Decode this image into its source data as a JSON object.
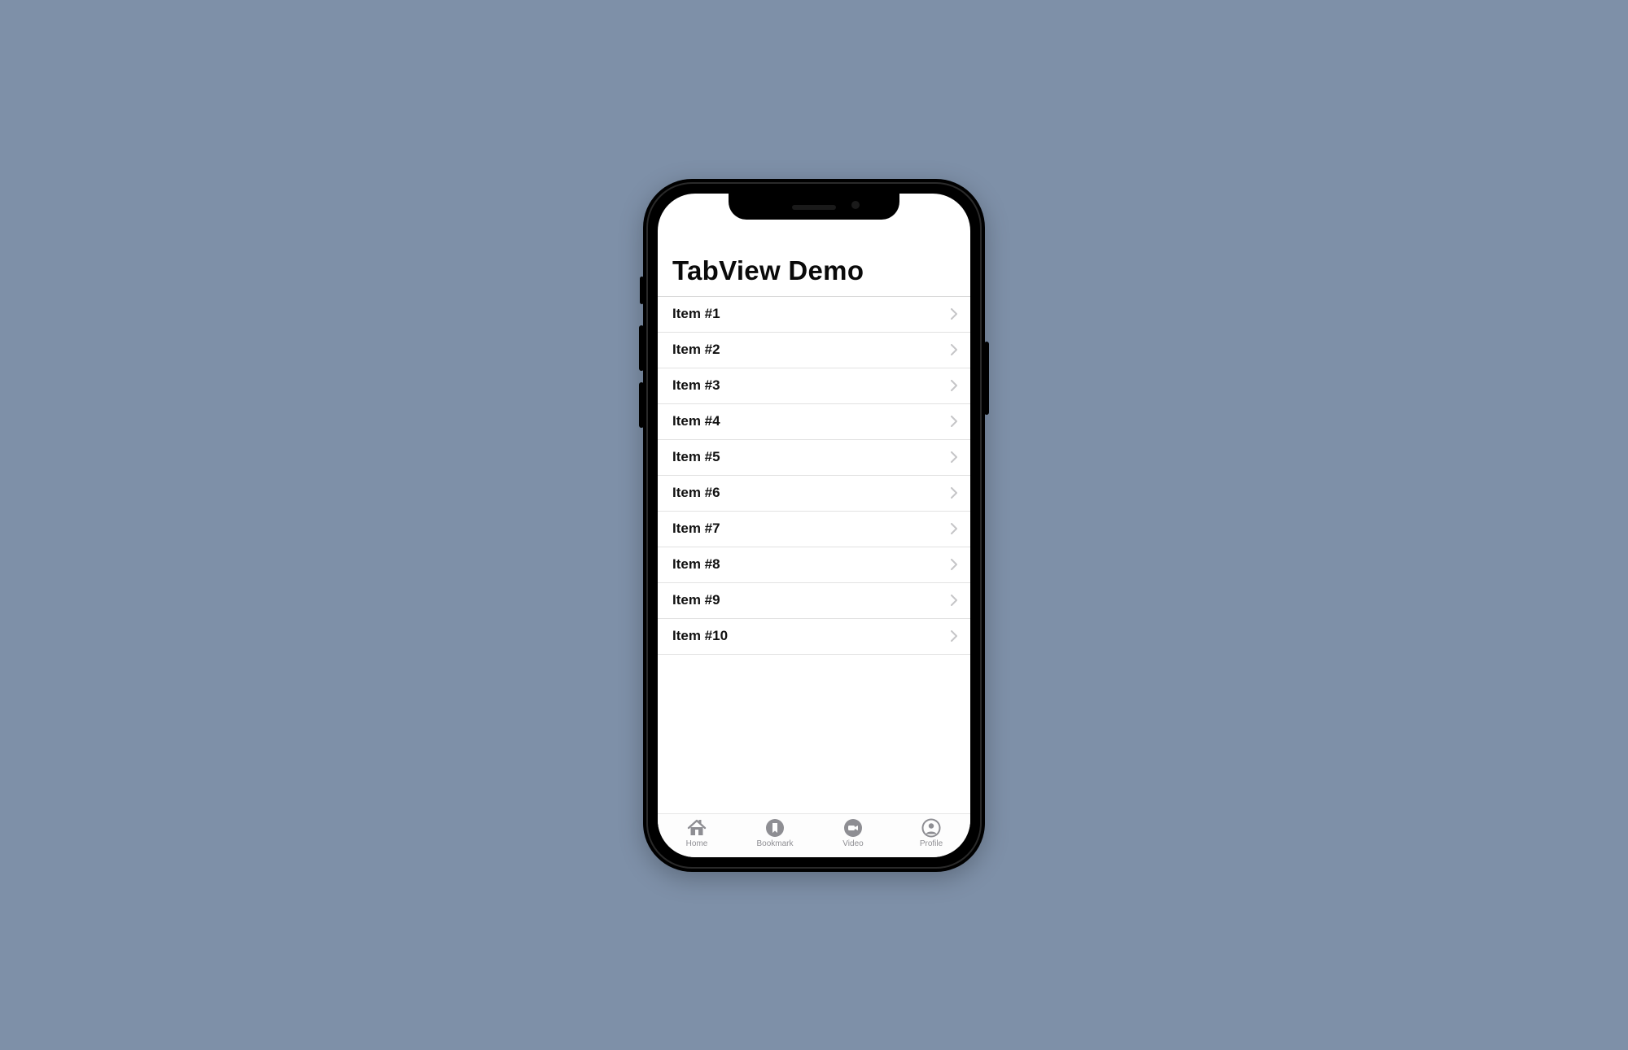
{
  "header": {
    "title": "TabView Demo"
  },
  "list": {
    "items": [
      {
        "label": "Item #1"
      },
      {
        "label": "Item #2"
      },
      {
        "label": "Item #3"
      },
      {
        "label": "Item #4"
      },
      {
        "label": "Item #5"
      },
      {
        "label": "Item #6"
      },
      {
        "label": "Item #7"
      },
      {
        "label": "Item #8"
      },
      {
        "label": "Item #9"
      },
      {
        "label": "Item #10"
      }
    ]
  },
  "tabs": [
    {
      "label": "Home",
      "icon": "house-icon"
    },
    {
      "label": "Bookmark",
      "icon": "bookmark-icon"
    },
    {
      "label": "Video",
      "icon": "video-icon"
    },
    {
      "label": "Profile",
      "icon": "profile-icon"
    }
  ],
  "colors": {
    "tabIcon": "#8e8e93",
    "chevron": "#c5c5c7"
  }
}
